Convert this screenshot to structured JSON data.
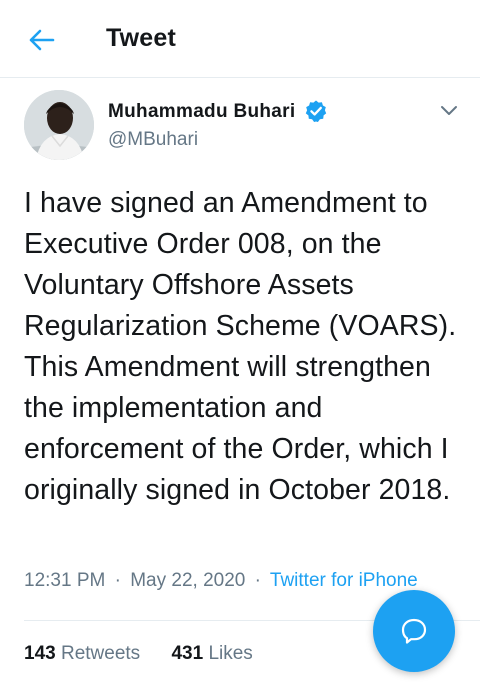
{
  "header": {
    "title": "Tweet",
    "back_icon": "arrow-left-icon"
  },
  "tweet": {
    "author_name": "Muhammadu Buhari",
    "handle": "@MBuhari",
    "verified": true,
    "text": "I have signed an Amendment to Executive Order 008, on the Voluntary Offshore Assets Regularization Scheme (VOARS). This Amendment will strengthen the implementation and enforcement of the Order, which I originally signed in October 2018.",
    "time": "12:31 PM",
    "date": "May 22, 2020",
    "separator": "·",
    "source": "Twitter for iPhone",
    "retweets_count": "143",
    "retweets_label": "Retweets",
    "likes_count": "431",
    "likes_label": "Likes"
  },
  "fab": {
    "icon": "compose-reply-icon"
  },
  "colors": {
    "accent": "#1da1f2",
    "text_primary": "#14171a",
    "text_secondary": "#657786",
    "border": "#e6ecf0"
  }
}
